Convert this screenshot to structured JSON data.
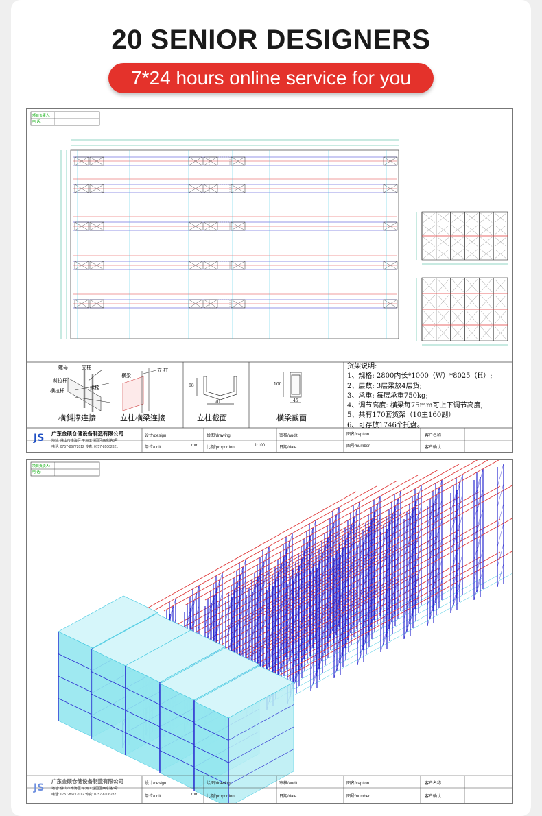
{
  "header": {
    "title": "20 SENIOR DESIGNERS",
    "subtitle": "7*24 hours online service for you"
  },
  "drawing1": {
    "corner_label_1": "项目负责人:",
    "corner_label_2": "电  话:",
    "notes_title": "货架说明:",
    "notes": [
      "1、规格: 2800内长*1000（W）*8025（H）;",
      "2、层数: 3层梁放4层货;",
      "3、承重: 每层承重750kg;",
      "4、调节高度: 横梁每75mm可上下调节高度;",
      "5、共有170套货架（10主160副）",
      "6、可存放1746个托盘。"
    ],
    "details": [
      {
        "caption": "横斜撑连接",
        "labels": [
          "螺母",
          "斜拉杆",
          "横拉杆",
          "立柱",
          "螺栓"
        ]
      },
      {
        "caption": "立柱横梁连接",
        "labels": [
          "横梁",
          "立 柱"
        ]
      },
      {
        "caption": "立柱截面",
        "labels": [
          "68",
          "90"
        ]
      },
      {
        "caption": "横梁截面",
        "labels": [
          "100",
          "45"
        ]
      }
    ],
    "title_block": {
      "company": "广东金硕仓储设备制造有限公司",
      "address": "地址: 佛山市南海区 平洲工业园区西东路3号",
      "phone": "电话: 0757-86772012   传真: 0757-81062821",
      "design": "设计/design",
      "drawing": "绘图/drawing",
      "audit": "审核/audit",
      "caption": "图名/caption",
      "customer": "客户名称",
      "unit": "单位/unit",
      "unit_value": "mm",
      "proportion": "比例/proportion",
      "proportion_value": "1:100",
      "date": "日期/date",
      "number": "图号/number",
      "confirm": "客户确认"
    }
  },
  "drawing2": {
    "corner_label_1": "项目负责人:",
    "corner_label_2": "电  话:",
    "title_block": {
      "company": "广东金硕仓储设备制造有限公司",
      "address": "地址: 佛山市南海区 平洲工业园区西东路3号",
      "phone": "电话: 0757-86772012   传真: 0757-81062821",
      "design": "设计/design",
      "drawing": "绘图/drawing",
      "audit": "审核/audit",
      "caption": "图名/caption",
      "customer": "客户名称",
      "unit": "单位/unit",
      "unit_value": "mm",
      "proportion": "比例/proportion",
      "date": "日期/date",
      "number": "图号/number",
      "confirm": "客户确认"
    }
  },
  "colors": {
    "accent_red": "#e4322b",
    "rack_blue": "#2a2ad0",
    "beam_red": "#e03a3a",
    "pallet_cyan": "#8fe6ef",
    "guide_cyan": "#3ec7e0"
  }
}
